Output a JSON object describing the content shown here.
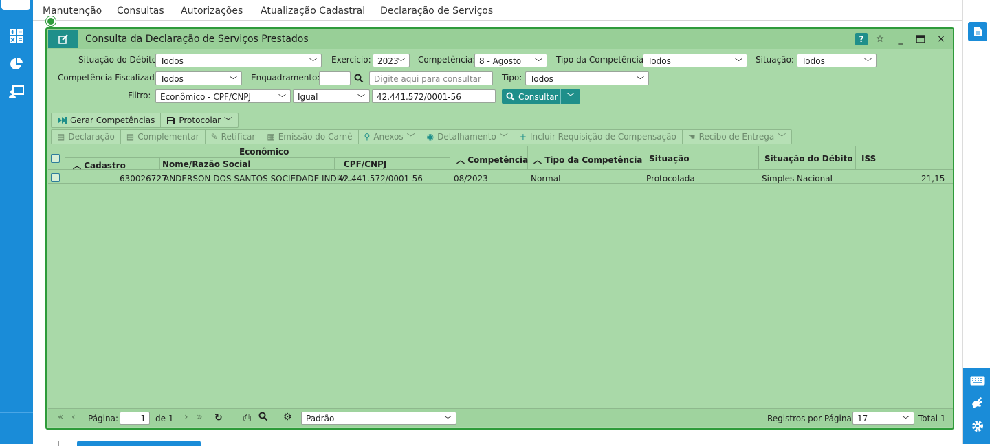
{
  "menu": {
    "items": [
      "Manutenção",
      "Consultas",
      "Autorizações",
      "Atualização Cadastral",
      "Declaração de Serviços"
    ]
  },
  "left_rail": {
    "icons": [
      "calculator-icon",
      "pie-chart-icon",
      "user-screen-icon"
    ]
  },
  "right_rail": {
    "icons": [
      "document-icon",
      "keyboard-icon",
      "sign-language-icon",
      "settings-icon"
    ]
  },
  "window": {
    "title": "Consulta da Declaração de Serviços Prestados",
    "help_label": "?"
  },
  "filters": {
    "situacao_debito": {
      "label": "Situação do Débito:",
      "value": "Todos"
    },
    "exercicio": {
      "label": "Exercício:",
      "value": "2023"
    },
    "competencia": {
      "label": "Competência:",
      "value": "8 - Agosto"
    },
    "tipo_competencia": {
      "label": "Tipo da Competência:",
      "value": "Todos"
    },
    "situacao": {
      "label": "Situação:",
      "value": "Todos"
    },
    "competencia_fiscalizada": {
      "label": "Competência Fiscalizada:",
      "value": "Todos"
    },
    "enquadramento": {
      "label": "Enquadramento:",
      "value": "",
      "placeholder": "Digite aqui para consultar"
    },
    "tipo": {
      "label": "Tipo:",
      "value": "Todos"
    },
    "filtro": {
      "label": "Filtro:",
      "field": "Econômico - CPF/CNPJ",
      "operator": "Igual",
      "value": "42.441.572/0001-56"
    },
    "consultar_label": "Consultar"
  },
  "toolbar_primary": [
    {
      "label": "Gerar Competências",
      "icon": "fast-forward-icon"
    },
    {
      "label": "Protocolar",
      "icon": "save-icon",
      "dropdown": true
    }
  ],
  "toolbar_secondary": [
    {
      "label": "Declaração",
      "icon": "archive-icon"
    },
    {
      "label": "Complementar",
      "icon": "archive-icon"
    },
    {
      "label": "Retificar",
      "icon": "pencil-icon"
    },
    {
      "label": "Emissão do Carnê",
      "icon": "file-icon"
    },
    {
      "label": "Anexos",
      "icon": "search-icon",
      "dropdown": true
    },
    {
      "label": "Detalhamento",
      "icon": "eye-icon",
      "dropdown": true
    },
    {
      "label": "Incluir Requisição de Compensação",
      "icon": "plus-icon"
    },
    {
      "label": "Recibo de Entrega",
      "icon": "hand-icon",
      "dropdown": true
    }
  ],
  "table": {
    "group_header": "Econômico",
    "columns": {
      "cadastro": "Cadastro",
      "nome": "Nome/Razão Social",
      "cpf": "CPF/CNPJ",
      "competencia": "Competência",
      "tipo_competencia": "Tipo da Competência",
      "situacao": "Situação",
      "situacao_debito": "Situação do Débito",
      "iss": "ISS"
    },
    "rows": [
      {
        "cadastro": "630026727",
        "nome": "ANDERSON DOS SANTOS SOCIEDADE INDIVI...",
        "cpf": "42.441.572/0001-56",
        "competencia": "08/2023",
        "tipo_competencia": "Normal",
        "situacao": "Protocolada",
        "situacao_debito": "Simples Nacional",
        "iss": "21,15"
      }
    ]
  },
  "pager": {
    "page_label": "Página:",
    "page_value": "1",
    "of_label": "de 1",
    "layout_value": "Padrão",
    "per_page_label": "Registros por Página:",
    "per_page_value": "17",
    "total_label": "Total 1"
  }
}
